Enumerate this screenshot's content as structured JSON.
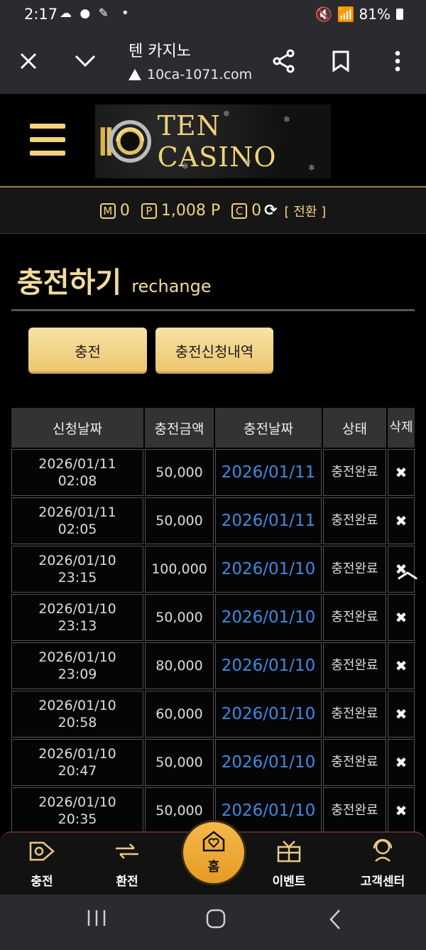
{
  "status_bar": {
    "time": "2:17",
    "notif_icons": "☁ ● ✎",
    "dot": "•",
    "signal": "📶",
    "battery": "81%"
  },
  "browser": {
    "title": "텐 카지노",
    "url": "10ca-1071.com",
    "close_icon": "✕",
    "down_icon": "⌄",
    "share_icon": "⋖",
    "bookmark_icon": "⌑",
    "more_icon": "⋮"
  },
  "site": {
    "logo_text": "TEN CASINO"
  },
  "points": {
    "m_label": "M",
    "m_value": "0",
    "p_label": "P",
    "p_value": "1,008 P",
    "c_label": "C",
    "c_value": "0",
    "convert_label": "[ 전환 ]"
  },
  "page": {
    "title": "충전하기",
    "subtitle": "rechange"
  },
  "tabs": {
    "charge": "충전",
    "history": "충전신청내역"
  },
  "table": {
    "headers": [
      "신청날짜",
      "충전금액",
      "충전날짜",
      "상태",
      "삭제"
    ],
    "rows": [
      {
        "req_date": "2026/01/11",
        "req_time": "02:08",
        "amount": "50,000",
        "date": "2026/01/11",
        "status": "충전완료"
      },
      {
        "req_date": "2026/01/11",
        "req_time": "02:05",
        "amount": "50,000",
        "date": "2026/01/11",
        "status": "충전완료"
      },
      {
        "req_date": "2026/01/10",
        "req_time": "23:15",
        "amount": "100,000",
        "date": "2026/01/10",
        "status": "충전완료"
      },
      {
        "req_date": "2026/01/10",
        "req_time": "23:13",
        "amount": "50,000",
        "date": "2026/01/10",
        "status": "충전완료"
      },
      {
        "req_date": "2026/01/10",
        "req_time": "23:09",
        "amount": "80,000",
        "date": "2026/01/10",
        "status": "충전완료"
      },
      {
        "req_date": "2026/01/10",
        "req_time": "20:58",
        "amount": "60,000",
        "date": "2026/01/10",
        "status": "충전완료"
      },
      {
        "req_date": "2026/01/10",
        "req_time": "20:47",
        "amount": "50,000",
        "date": "2026/01/10",
        "status": "충전완료"
      },
      {
        "req_date": "2026/01/10",
        "req_time": "20:35",
        "amount": "50,000",
        "date": "2026/01/10",
        "status": "충전완료"
      }
    ],
    "delete_icon": "✖"
  },
  "bottom_nav": {
    "charge": "충전",
    "exchange": "환전",
    "home": "홈",
    "event": "이벤트",
    "support": "고객센터"
  }
}
